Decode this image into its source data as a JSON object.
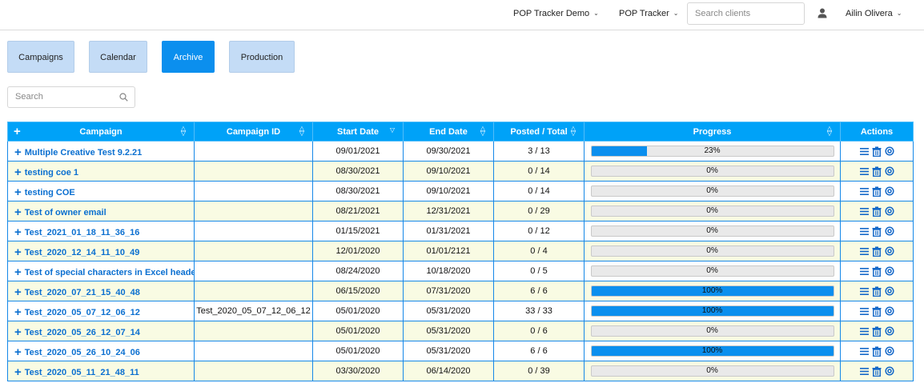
{
  "topbar": {
    "workspace": "POP Tracker Demo",
    "app": "POP Tracker",
    "search_placeholder": "Search clients",
    "user_name": "Ailin Olivera"
  },
  "tabs": [
    {
      "label": "Campaigns",
      "active": false
    },
    {
      "label": "Calendar",
      "active": false
    },
    {
      "label": "Archive",
      "active": true
    },
    {
      "label": "Production",
      "active": false
    }
  ],
  "search": {
    "placeholder": "Search"
  },
  "table": {
    "headers": {
      "add": "+",
      "campaign": "Campaign",
      "campaign_id": "Campaign ID",
      "start_date": "Start Date",
      "end_date": "End Date",
      "posted_total": "Posted / Total",
      "progress": "Progress",
      "actions": "Actions"
    },
    "rows": [
      {
        "campaign": "Multiple Creative Test 9.2.21",
        "campaign_id": "",
        "start": "09/01/2021",
        "end": "09/30/2021",
        "posted": "3 / 13",
        "progress_label": "23%",
        "progress": 0.23
      },
      {
        "campaign": "testing coe 1",
        "campaign_id": "",
        "start": "08/30/2021",
        "end": "09/10/2021",
        "posted": "0 / 14",
        "progress_label": "0%",
        "progress": 0
      },
      {
        "campaign": "testing COE",
        "campaign_id": "",
        "start": "08/30/2021",
        "end": "09/10/2021",
        "posted": "0 / 14",
        "progress_label": "0%",
        "progress": 0
      },
      {
        "campaign": "Test of owner email",
        "campaign_id": "",
        "start": "08/21/2021",
        "end": "12/31/2021",
        "posted": "0 / 29",
        "progress_label": "0%",
        "progress": 0
      },
      {
        "campaign": "Test_2021_01_18_11_36_16",
        "campaign_id": "",
        "start": "01/15/2021",
        "end": "01/31/2021",
        "posted": "0 / 12",
        "progress_label": "0%",
        "progress": 0
      },
      {
        "campaign": "Test_2020_12_14_11_10_49",
        "campaign_id": "",
        "start": "12/01/2020",
        "end": "01/01/2121",
        "posted": "0 / 4",
        "progress_label": "0%",
        "progress": 0
      },
      {
        "campaign": "Test of special characters in Excel headers",
        "campaign_id": "",
        "start": "08/24/2020",
        "end": "10/18/2020",
        "posted": "0 / 5",
        "progress_label": "0%",
        "progress": 0
      },
      {
        "campaign": "Test_2020_07_21_15_40_48",
        "campaign_id": "",
        "start": "06/15/2020",
        "end": "07/31/2020",
        "posted": "6 / 6",
        "progress_label": "100%",
        "progress": 1
      },
      {
        "campaign": "Test_2020_05_07_12_06_12",
        "campaign_id": "Test_2020_05_07_12_06_12",
        "start": "05/01/2020",
        "end": "05/31/2020",
        "posted": "33 / 33",
        "progress_label": "100%",
        "progress": 1
      },
      {
        "campaign": "Test_2020_05_26_12_07_14",
        "campaign_id": "",
        "start": "05/01/2020",
        "end": "05/31/2020",
        "posted": "0 / 6",
        "progress_label": "0%",
        "progress": 0
      },
      {
        "campaign": "Test_2020_05_26_10_24_06",
        "campaign_id": "",
        "start": "05/01/2020",
        "end": "05/31/2020",
        "posted": "6 / 6",
        "progress_label": "100%",
        "progress": 1
      },
      {
        "campaign": "Test_2020_05_11_21_48_11",
        "campaign_id": "",
        "start": "03/30/2020",
        "end": "06/14/2020",
        "posted": "0 / 39",
        "progress_label": "0%",
        "progress": 0
      }
    ]
  },
  "colors": {
    "accent": "#0b8fee",
    "header_bg": "#00a2f8",
    "tab_inactive": "#c4dcf6",
    "row_alt": "#f9fbe3",
    "link": "#0a6fd0"
  },
  "icons": [
    "chevron-down-icon",
    "user-icon",
    "search-icon",
    "plus-icon",
    "sort-icon",
    "list-icon",
    "trash-icon",
    "target-icon"
  ]
}
